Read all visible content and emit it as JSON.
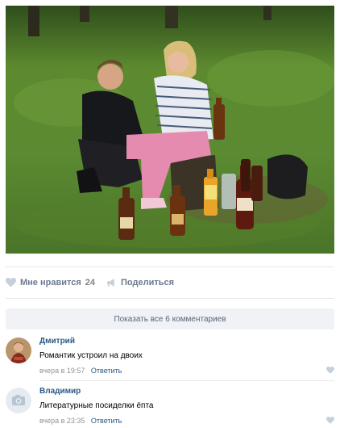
{
  "post": {
    "actions": {
      "like_label": "Мне нравится",
      "like_count": "24",
      "share_label": "Поделиться"
    },
    "show_all_label": "Показать все 6 комментариев"
  },
  "comments": [
    {
      "author": "Дмитрий",
      "text": "Романтик устроил на двоих",
      "date": "вчера в 19:57",
      "reply_label": "Ответить"
    },
    {
      "author": "Владимир",
      "text": "Литературные посиделки ёпта",
      "date": "вчера в 23:35",
      "reply_label": "Ответить"
    }
  ],
  "colors": {
    "link": "#2a5885",
    "muted": "#828282",
    "heart": "#c5d0db"
  }
}
